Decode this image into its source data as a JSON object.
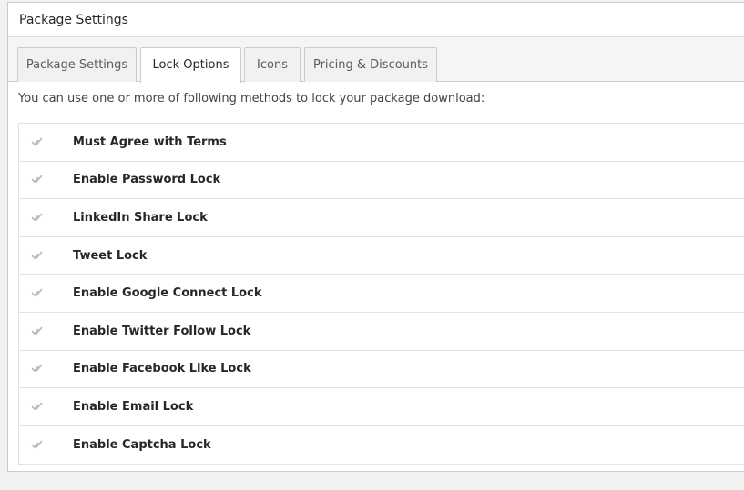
{
  "panel": {
    "title": "Package Settings"
  },
  "tabs": [
    {
      "label": "Package Settings",
      "active": false
    },
    {
      "label": "Lock Options",
      "active": true
    },
    {
      "label": "Icons",
      "active": false
    },
    {
      "label": "Pricing & Discounts",
      "active": false
    }
  ],
  "intro": "You can use one or more of following methods to lock your package download:",
  "locks": [
    {
      "label": "Must Agree with Terms",
      "icon": "double-check-icon"
    },
    {
      "label": "Enable Password Lock",
      "icon": "double-check-icon"
    },
    {
      "label": "LinkedIn Share Lock",
      "icon": "double-check-icon"
    },
    {
      "label": "Tweet Lock",
      "icon": "double-check-icon"
    },
    {
      "label": "Enable Google Connect Lock",
      "icon": "double-check-icon"
    },
    {
      "label": "Enable Twitter Follow Lock",
      "icon": "double-check-icon"
    },
    {
      "label": "Enable Facebook Like Lock",
      "icon": "double-check-icon"
    },
    {
      "label": "Enable Email Lock",
      "icon": "double-check-icon"
    },
    {
      "label": "Enable Captcha Lock",
      "icon": "double-check-icon"
    }
  ],
  "colors": {
    "icon": "#b4b9be",
    "border": "#dde3ea"
  }
}
